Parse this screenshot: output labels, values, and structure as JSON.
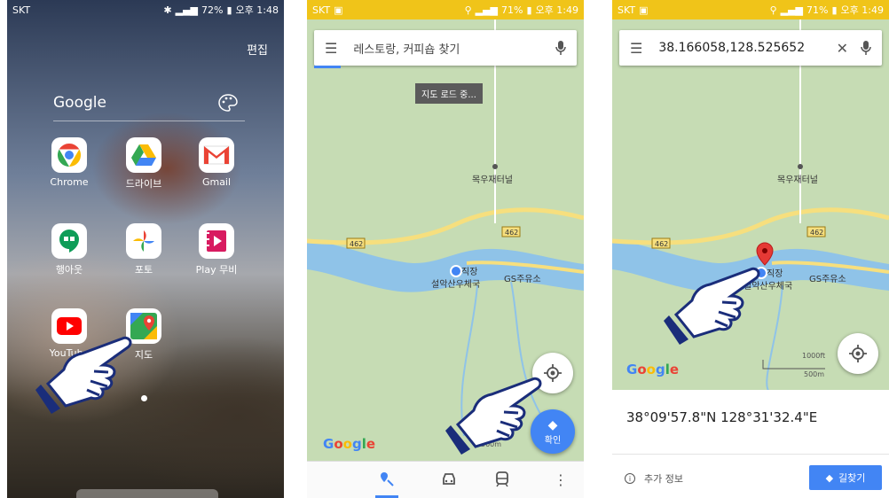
{
  "phone1": {
    "status": {
      "carrier": "SKT",
      "battery": "72%",
      "time": "오후 1:48"
    },
    "edit_label": "편집",
    "folder_title": "Google",
    "apps": [
      {
        "label": "Chrome",
        "icon": "chrome-icon"
      },
      {
        "label": "드라이브",
        "icon": "drive-icon"
      },
      {
        "label": "Gmail",
        "icon": "gmail-icon"
      },
      {
        "label": "행아웃",
        "icon": "hangouts-icon"
      },
      {
        "label": "포토",
        "icon": "photos-icon"
      },
      {
        "label": "Play 무비",
        "icon": "play-movies-icon"
      },
      {
        "label": "YouTube",
        "icon": "youtube-icon"
      },
      {
        "label": "지도",
        "icon": "maps-icon"
      }
    ]
  },
  "phone2": {
    "status": {
      "carrier": "SKT",
      "battery": "71%",
      "time": "오후 1:49"
    },
    "search_placeholder": "레스토랑, 커피숍 찾기",
    "loading_badge": "지도 로드 중...",
    "map": {
      "tunnel_label": "목우재터널",
      "road_number": "462",
      "place_label_1": "직장",
      "place_label_2": "설악산우체국",
      "gas_station_label": "GS주유소",
      "scale_label": "500m"
    },
    "fab_label": "확인",
    "google_logo": "Google"
  },
  "phone3": {
    "status": {
      "carrier": "SKT",
      "battery": "71%",
      "time": "오후 1:49"
    },
    "search_value": "38.166058,128.525652",
    "map": {
      "tunnel_label": "목우재터널",
      "road_number": "462",
      "place_label_1": "직장",
      "place_label_2": "설악산우체국",
      "gas_station_label": "GS주유소",
      "scale_ft": "1000ft",
      "scale_m": "500m"
    },
    "google_logo": "Google",
    "coords_dms": "38°09'57.8\"N 128°31'32.4\"E",
    "more_info_label": "추가 정보",
    "directions_label": "길찾기"
  },
  "colors": {
    "map_green": "#c6dcb4",
    "river_blue": "#8fc3e8",
    "road_yellow": "#f6df7e",
    "accent_blue": "#4285f4",
    "pin_red": "#e53935"
  }
}
